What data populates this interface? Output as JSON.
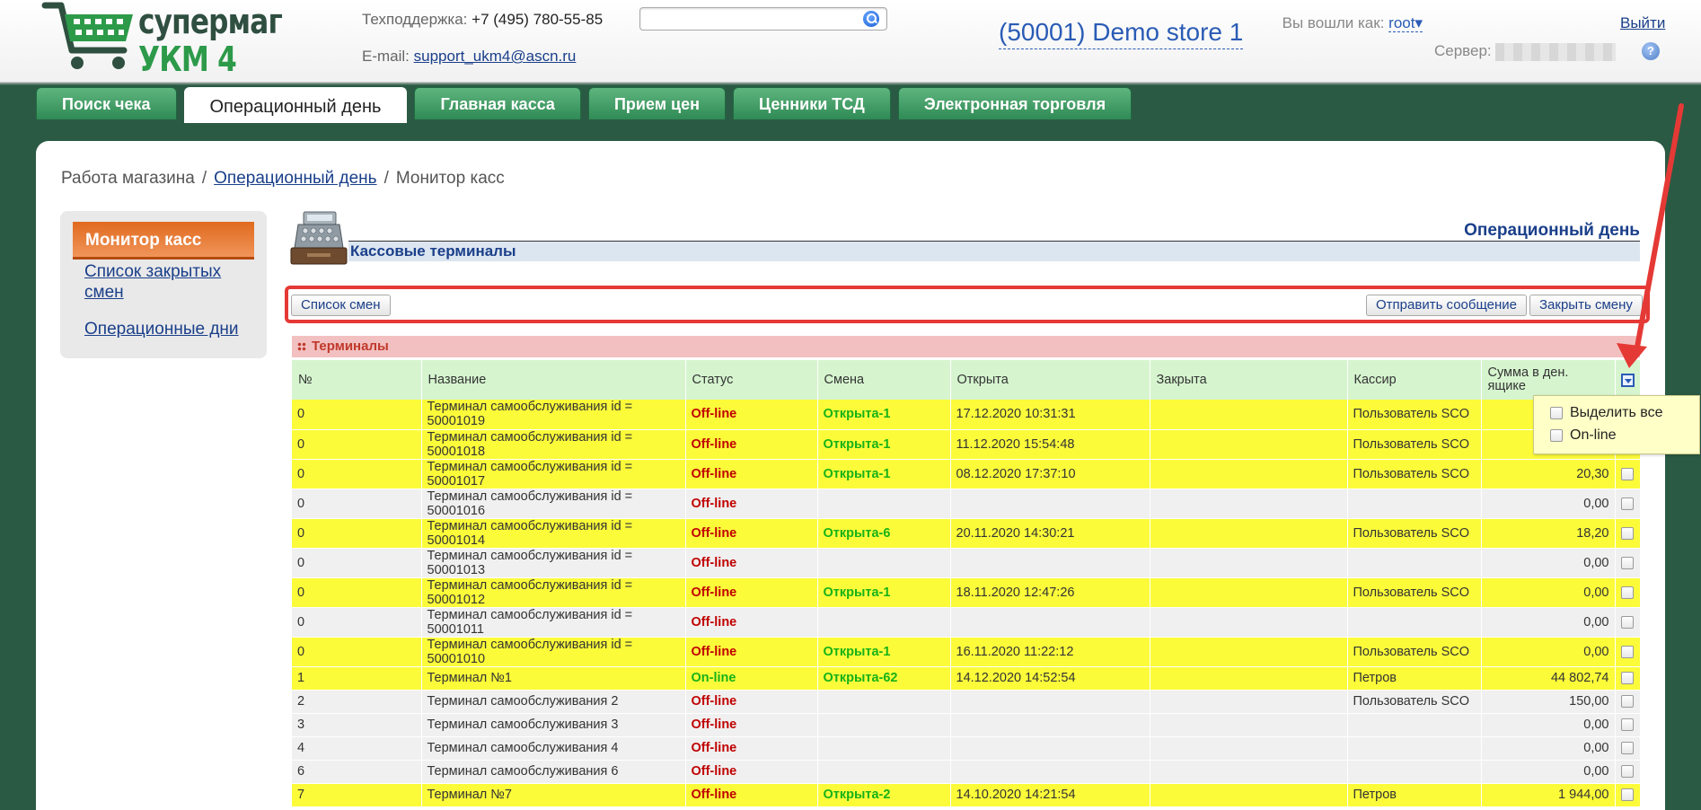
{
  "header": {
    "logo_line1": "супермаг",
    "logo_line2": "УКМ 4",
    "support_label": "Техподдержка:",
    "support_phone": "+7 (495) 780-55-85",
    "email_label": "E-mail:",
    "email": "support_ukm4@ascn.ru",
    "search_value": "",
    "store": "(50001) Demo store 1",
    "logged_label": "Вы вошли как:",
    "user": "root",
    "logout": "Выйти",
    "server_label": "Сервер:",
    "help": "?"
  },
  "tabs": [
    {
      "label": "Поиск чека"
    },
    {
      "label": "Операционный день"
    },
    {
      "label": "Главная касса"
    },
    {
      "label": "Прием цен"
    },
    {
      "label": "Ценники ТСД"
    },
    {
      "label": "Электронная торговля"
    }
  ],
  "breadcrumb": {
    "root": "Работа магазина",
    "middle": "Операционный день",
    "current": "Монитор касс"
  },
  "sidebar": {
    "active": "Монитор касс",
    "items": [
      "Список закрытых смен",
      "Операционные дни"
    ]
  },
  "main": {
    "page_title": "Операционный день",
    "section_title": "Кассовые терминалы",
    "btn_shifts": "Список смен",
    "btn_message": "Отправить сообщение",
    "btn_close": "Закрыть смену",
    "table_title": "Терминалы"
  },
  "table": {
    "headers": [
      "№",
      "Название",
      "Статус",
      "Смена",
      "Открыта",
      "Закрыта",
      "Кассир",
      "Сумма в ден. ящике"
    ],
    "rows": [
      {
        "n": "0",
        "name": "Терминал самообслуживания id = 50001019",
        "status": "Off-line",
        "shift": "Открыта-1",
        "opened": "17.12.2020 10:31:31",
        "closed": "",
        "cashier": "Пользователь SCO",
        "sum": ""
      },
      {
        "n": "0",
        "name": "Терминал самообслуживания id = 50001018",
        "status": "Off-line",
        "shift": "Открыта-1",
        "opened": "11.12.2020 15:54:48",
        "closed": "",
        "cashier": "Пользователь SCO",
        "sum": ""
      },
      {
        "n": "0",
        "name": "Терминал самообслуживания id = 50001017",
        "status": "Off-line",
        "shift": "Открыта-1",
        "opened": "08.12.2020 17:37:10",
        "closed": "",
        "cashier": "Пользователь SCO",
        "sum": "20,30"
      },
      {
        "n": "0",
        "name": "Терминал самообслуживания id = 50001016",
        "status": "Off-line",
        "shift": "",
        "opened": "",
        "closed": "",
        "cashier": "",
        "sum": "0,00"
      },
      {
        "n": "0",
        "name": "Терминал самообслуживания id = 50001014",
        "status": "Off-line",
        "shift": "Открыта-6",
        "opened": "20.11.2020 14:30:21",
        "closed": "",
        "cashier": "Пользователь SCO",
        "sum": "18,20"
      },
      {
        "n": "0",
        "name": "Терминал самообслуживания id = 50001013",
        "status": "Off-line",
        "shift": "",
        "opened": "",
        "closed": "",
        "cashier": "",
        "sum": "0,00"
      },
      {
        "n": "0",
        "name": "Терминал самообслуживания id = 50001012",
        "status": "Off-line",
        "shift": "Открыта-1",
        "opened": "18.11.2020 12:47:26",
        "closed": "",
        "cashier": "Пользователь SCO",
        "sum": "0,00"
      },
      {
        "n": "0",
        "name": "Терминал самообслуживания id = 50001011",
        "status": "Off-line",
        "shift": "",
        "opened": "",
        "closed": "",
        "cashier": "",
        "sum": "0,00"
      },
      {
        "n": "0",
        "name": "Терминал самообслуживания id = 50001010",
        "status": "Off-line",
        "shift": "Открыта-1",
        "opened": "16.11.2020 11:22:12",
        "closed": "",
        "cashier": "Пользователь SCO",
        "sum": "0,00"
      },
      {
        "n": "1",
        "name": "Терминал №1",
        "status": "On-line",
        "shift": "Открыта-62",
        "opened": "14.12.2020 14:52:54",
        "closed": "",
        "cashier": "Петров",
        "sum": "44 802,74"
      },
      {
        "n": "2",
        "name": "Терминал самообслуживания 2",
        "status": "Off-line",
        "shift": "",
        "opened": "",
        "closed": "",
        "cashier": "Пользователь SCO",
        "sum": "150,00"
      },
      {
        "n": "3",
        "name": "Терминал самообслуживания 3",
        "status": "Off-line",
        "shift": "",
        "opened": "",
        "closed": "",
        "cashier": "",
        "sum": "0,00"
      },
      {
        "n": "4",
        "name": "Терминал самообслуживания 4",
        "status": "Off-line",
        "shift": "",
        "opened": "",
        "closed": "",
        "cashier": "",
        "sum": "0,00"
      },
      {
        "n": "6",
        "name": "Терминал самообслуживания 6",
        "status": "Off-line",
        "shift": "",
        "opened": "",
        "closed": "",
        "cashier": "",
        "sum": "0,00"
      },
      {
        "n": "7",
        "name": "Терминал №7",
        "status": "Off-line",
        "shift": "Открыта-2",
        "opened": "14.10.2020 14:21:54",
        "closed": "",
        "cashier": "Петров",
        "sum": "1 944,00"
      }
    ]
  },
  "popup": {
    "items": [
      "Выделить все",
      "On-line"
    ]
  },
  "colors": {
    "background": "#2b5a44",
    "tab": "#3d9b62",
    "link": "#1a3f8a",
    "row_highlight": "#fbfb3a",
    "header_row": "#d6f5cf",
    "offline": "#c00000",
    "online": "#17b217",
    "annotation": "#e53935"
  }
}
